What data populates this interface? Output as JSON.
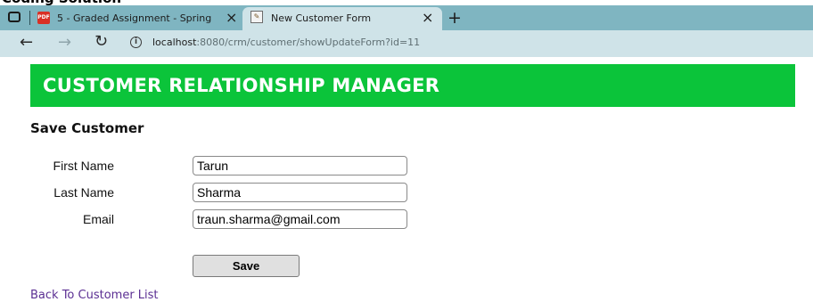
{
  "tabs": [
    {
      "title": "5 - Graded Assignment - Spring",
      "icon": "pdf-icon",
      "icon_text": "PDF",
      "active": false
    },
    {
      "title": "New Customer Form",
      "icon": "form-icon",
      "active": true
    }
  ],
  "address_bar": {
    "host": "localhost",
    "path": ":8080/crm/customer/showUpdateForm?id=11"
  },
  "header": {
    "title": "CUSTOMER RELATIONSHIP MANAGER",
    "bg_color": "#0bc43a"
  },
  "page": {
    "title": "Save Customer"
  },
  "form": {
    "first_name": {
      "label": "First Name",
      "value": "Tarun"
    },
    "last_name": {
      "label": "Last Name",
      "value": "Sharma"
    },
    "email": {
      "label": "Email",
      "value": "traun.sharma@gmail.com"
    },
    "save_label": "Save"
  },
  "links": {
    "back": "Back To Customer List"
  }
}
